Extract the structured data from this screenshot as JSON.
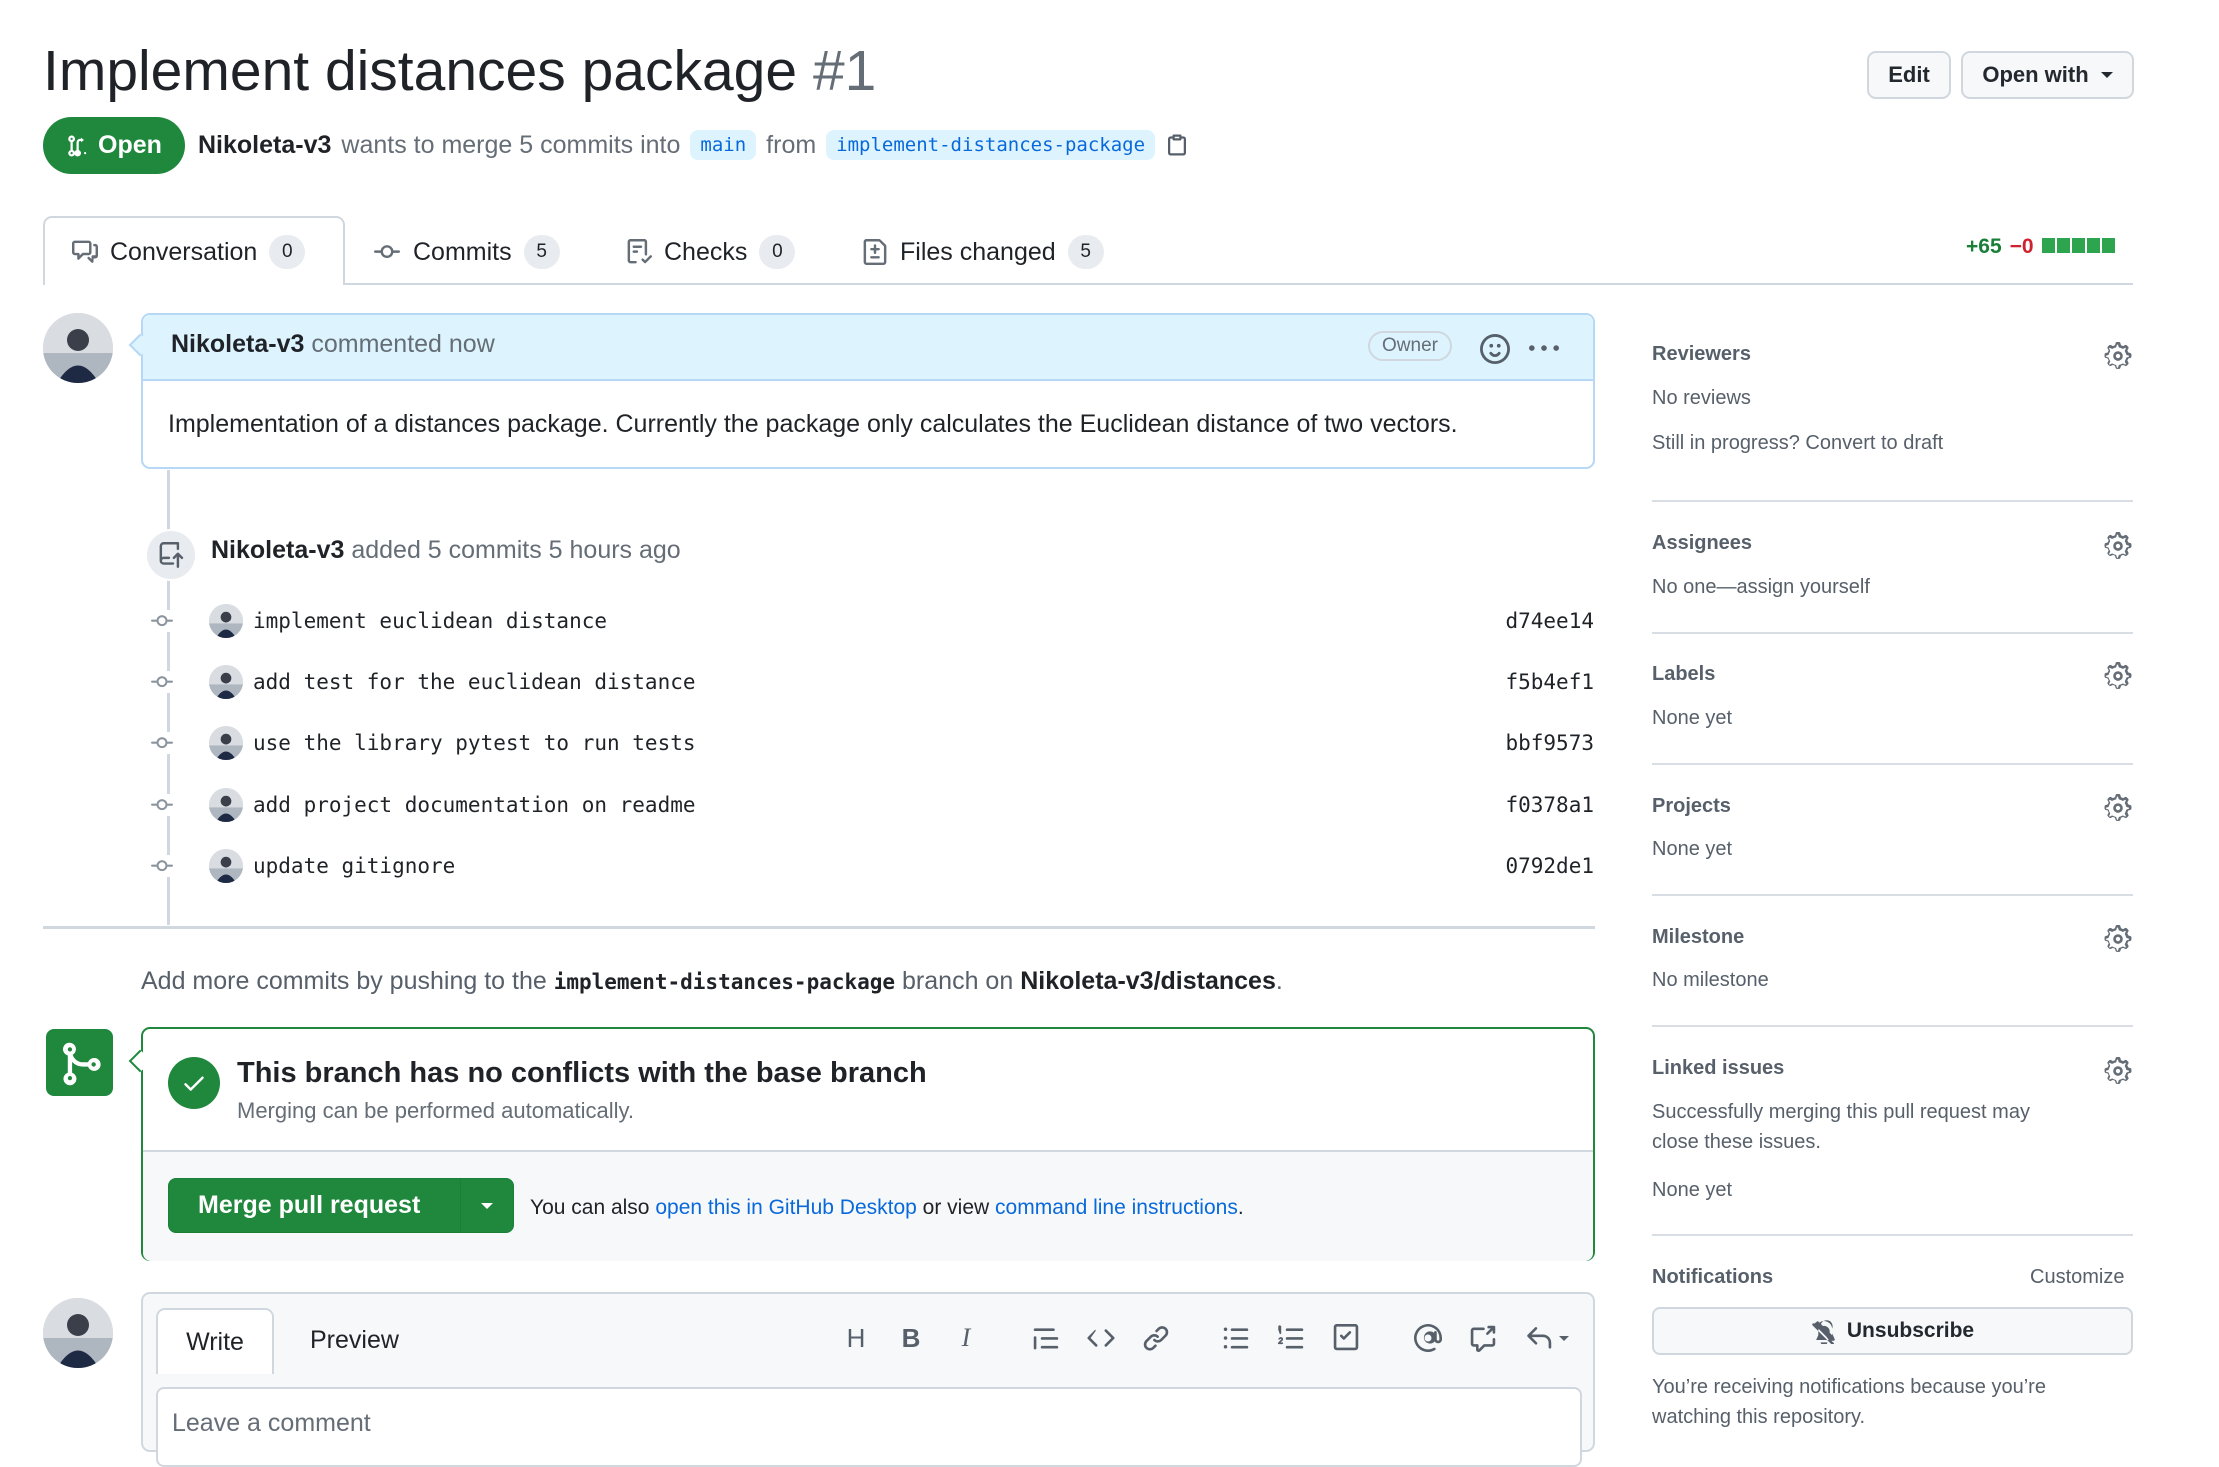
{
  "header": {
    "title": "Implement distances package",
    "number": "#1",
    "edit_label": "Edit",
    "open_with_label": "Open with",
    "state": "Open",
    "author": "Nikoleta-v3",
    "merge_text": "wants to merge 5 commits into",
    "base_branch": "main",
    "from_text": "from",
    "head_branch": "implement-distances-package"
  },
  "tabs": [
    {
      "label": "Conversation",
      "count": "0"
    },
    {
      "label": "Commits",
      "count": "5"
    },
    {
      "label": "Checks",
      "count": "0"
    },
    {
      "label": "Files changed",
      "count": "5"
    }
  ],
  "diffstat": {
    "additions": "+65",
    "deletions": "−0"
  },
  "comment": {
    "author": "Nikoleta-v3",
    "action": "commented now",
    "badge": "Owner",
    "body": "Implementation of a distances package. Currently the package only calculates the Euclidean distance of two vectors."
  },
  "commits_event": {
    "author": "Nikoleta-v3",
    "text": "added 5 commits 5 hours ago",
    "commits": [
      {
        "message": "implement euclidean distance",
        "sha": "d74ee14"
      },
      {
        "message": "add test for the euclidean distance",
        "sha": "f5b4ef1"
      },
      {
        "message": "use the library pytest to run tests",
        "sha": "bbf9573"
      },
      {
        "message": "add project documentation on readme",
        "sha": "f0378a1"
      },
      {
        "message": "update gitignore",
        "sha": "0792de1"
      }
    ]
  },
  "push_hint": {
    "prefix": "Add more commits by pushing to the",
    "branch": "implement-distances-package",
    "middle": "branch on",
    "repo": "Nikoleta-v3/distances",
    "suffix": "."
  },
  "merge": {
    "title": "This branch has no conflicts with the base branch",
    "subtitle": "Merging can be performed automatically.",
    "button": "Merge pull request",
    "also_text": "You can also",
    "desktop_link": "open this in GitHub Desktop",
    "or_view": "or view",
    "cli_link": "command line instructions",
    "period": "."
  },
  "editor": {
    "write_tab": "Write",
    "preview_tab": "Preview",
    "placeholder": "Leave a comment"
  },
  "sidebar": {
    "reviewers": {
      "title": "Reviewers",
      "value": "No reviews",
      "extra": "Still in progress? Convert to draft"
    },
    "assignees": {
      "title": "Assignees",
      "value": "No one—assign yourself"
    },
    "labels": {
      "title": "Labels",
      "value": "None yet"
    },
    "projects": {
      "title": "Projects",
      "value": "None yet"
    },
    "milestone": {
      "title": "Milestone",
      "value": "No milestone"
    },
    "linked": {
      "title": "Linked issues",
      "line1": "Successfully merging this pull request may",
      "line2": "close these issues.",
      "value": "None yet"
    },
    "notifications": {
      "title": "Notifications",
      "customize": "Customize",
      "button": "Unsubscribe",
      "line1": "You’re receiving notifications because you’re",
      "line2": "watching this repository."
    }
  },
  "colors": {
    "accent_green": "#1f883d",
    "link_blue": "#0969da",
    "muted": "#656d76",
    "deletion_red": "#cf222e"
  }
}
